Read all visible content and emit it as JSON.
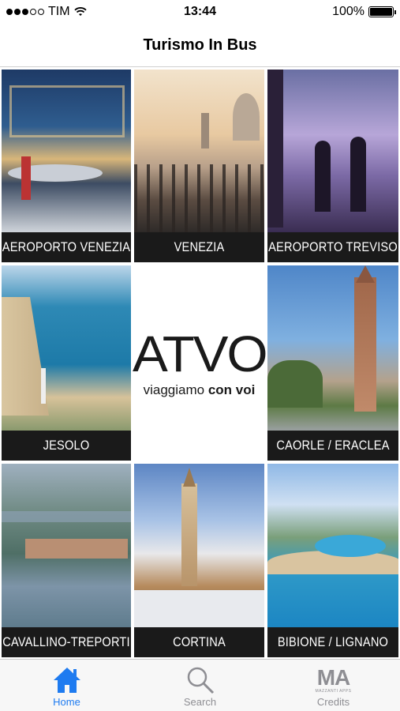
{
  "status_bar": {
    "carrier": "TIM",
    "time": "13:44",
    "battery": "100%"
  },
  "nav": {
    "title": "Turismo In Bus"
  },
  "tiles": [
    {
      "label": "AEROPORTO VENEZIA"
    },
    {
      "label": "VENEZIA"
    },
    {
      "label": "AEROPORTO TREVISO"
    },
    {
      "label": "JESOLO"
    },
    {
      "label": "CAORLE / ERACLEA"
    },
    {
      "label": "CAVALLINO-TREPORTI"
    },
    {
      "label": "CORTINA"
    },
    {
      "label": "BIBIONE / LIGNANO"
    }
  ],
  "logo": {
    "main": "ATVO",
    "sub_light": "viaggiamo ",
    "sub_bold": "con voi"
  },
  "tab_bar": {
    "tabs": [
      {
        "label": "Home",
        "icon": "home-icon"
      },
      {
        "label": "Search",
        "icon": "search-icon"
      },
      {
        "label": "Credits",
        "icon": "mazzanti-apps-logo"
      }
    ],
    "credits_logo_text": "MA",
    "credits_logo_sub": "MAZZANTI APPS"
  },
  "colors": {
    "accent": "#1e7bf0",
    "label_bg": "#1a1a1a",
    "tab_inactive": "#8e8e93"
  }
}
